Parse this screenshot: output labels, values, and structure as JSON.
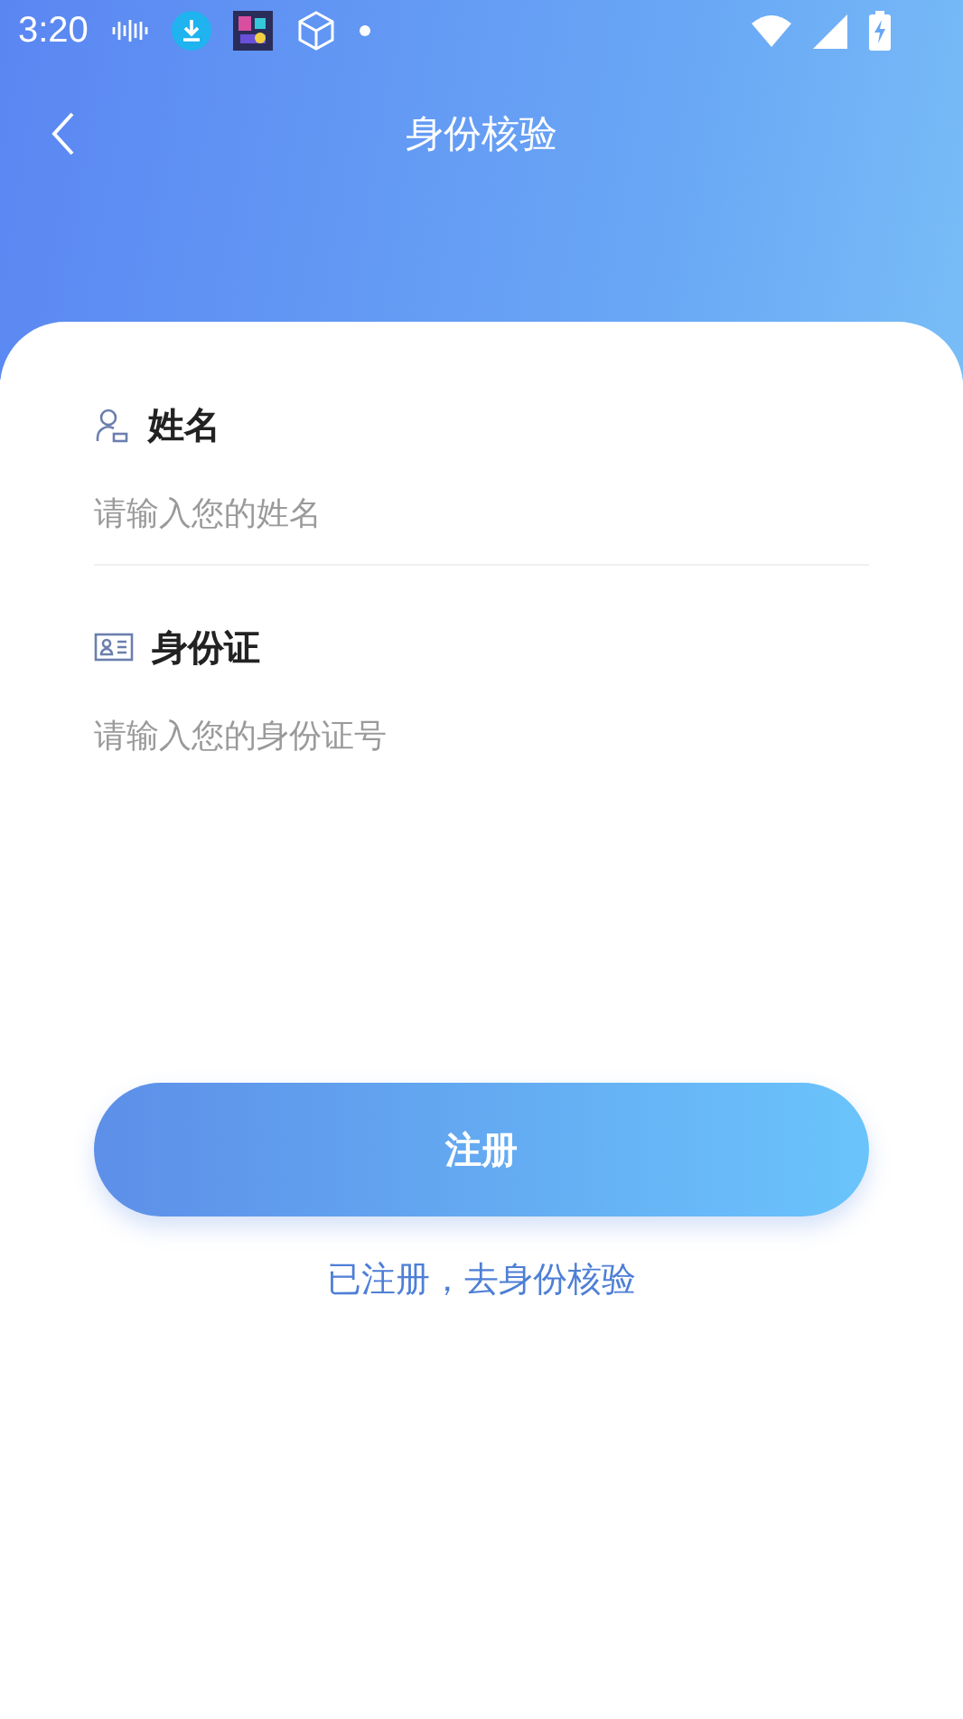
{
  "status_bar": {
    "time": "3:20"
  },
  "header": {
    "title": "身份核验"
  },
  "fields": [
    {
      "kind": "person",
      "label": "姓名",
      "placeholder": "请输入您的姓名"
    },
    {
      "kind": "id-card",
      "label": "身份证",
      "placeholder": "请输入您的身份证号"
    }
  ],
  "submit": {
    "label": "注册"
  },
  "link": {
    "label": "已注册，去身份核验"
  }
}
